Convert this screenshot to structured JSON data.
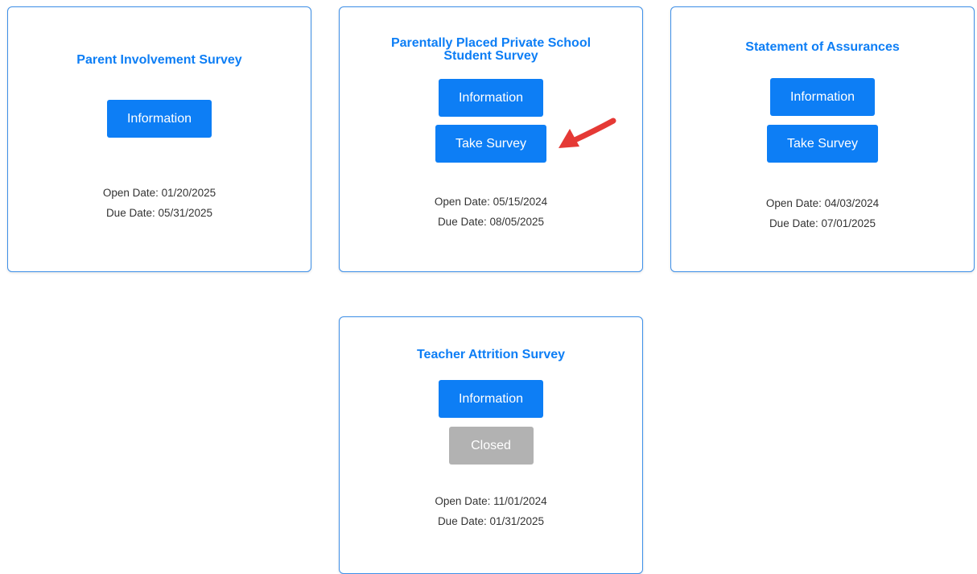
{
  "colors": {
    "accent": "#0d7ef5",
    "card_border": "#3d8fe8",
    "closed_button": "#b2b2b2",
    "annotation_arrow": "#e53935"
  },
  "surveys": [
    {
      "title": "Parent Involvement Survey",
      "info_label": "Information",
      "open_date": "Open Date: 01/20/2025",
      "due_date": "Due Date: 05/31/2025"
    },
    {
      "title": "Parentally Placed Private School Student Survey",
      "info_label": "Information",
      "action_label": "Take Survey",
      "open_date": "Open Date: 05/15/2024",
      "due_date": "Due Date: 08/05/2025"
    },
    {
      "title": "Statement of Assurances",
      "info_label": "Information",
      "action_label": "Take Survey",
      "open_date": "Open Date: 04/03/2024",
      "due_date": "Due Date: 07/01/2025"
    },
    {
      "title": "Teacher Attrition Survey",
      "info_label": "Information",
      "action_label": "Closed",
      "open_date": "Open Date: 11/01/2024",
      "due_date": "Due Date: 01/31/2025"
    }
  ],
  "annotation": {
    "icon": "red-pointer-arrow-icon"
  }
}
